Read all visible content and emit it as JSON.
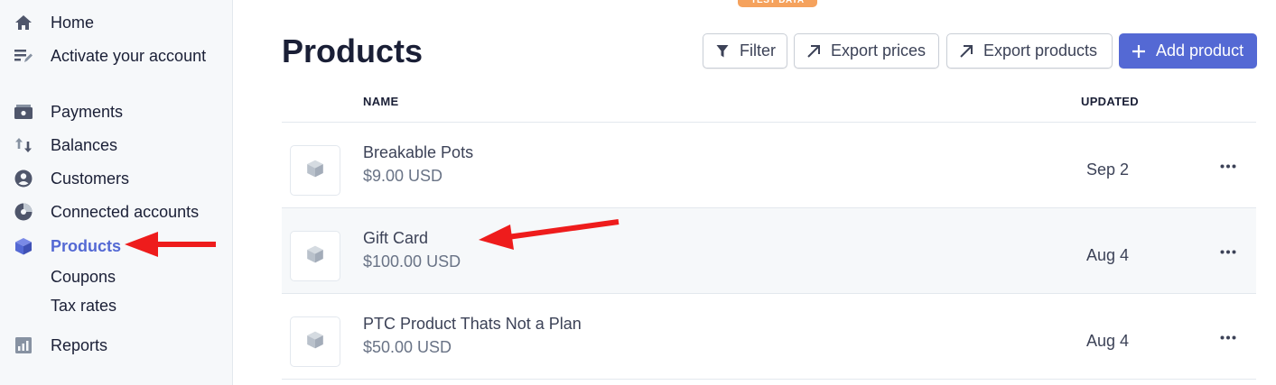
{
  "badge": "TEST DATA",
  "sidebar": {
    "home": "Home",
    "activate": "Activate your account",
    "payments": "Payments",
    "balances": "Balances",
    "customers": "Customers",
    "connected": "Connected accounts",
    "products": "Products",
    "coupons": "Coupons",
    "tax_rates": "Tax rates",
    "reports": "Reports"
  },
  "header": {
    "title": "Products",
    "filter": "Filter",
    "export_prices": "Export prices",
    "export_products": "Export products",
    "add_product": "Add product"
  },
  "table": {
    "col_name": "NAME",
    "col_updated": "UPDATED",
    "rows": [
      {
        "name": "Breakable Pots",
        "price": "$9.00 USD",
        "updated": "Sep 2"
      },
      {
        "name": "Gift Card",
        "price": "$100.00 USD",
        "updated": "Aug 4"
      },
      {
        "name": "PTC Product Thats Not a Plan",
        "price": "$50.00 USD",
        "updated": "Aug 4"
      }
    ]
  },
  "colors": {
    "accent": "#5469d4",
    "annotation_arrow": "#ee1c1c",
    "badge": "#f5a25d"
  }
}
